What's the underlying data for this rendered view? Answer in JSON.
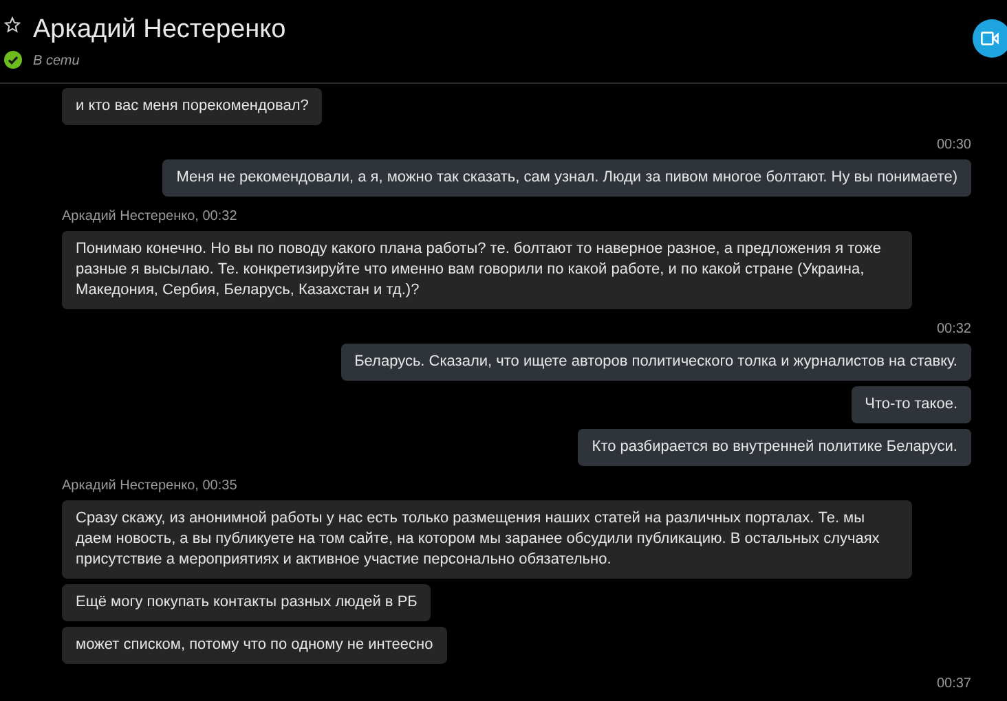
{
  "header": {
    "name": "Аркадий Нестеренко",
    "status": "В сети",
    "online": true
  },
  "groups": [
    {
      "kind": "incoming",
      "messages": [
        "и кто вас меня порекомендовал?"
      ]
    },
    {
      "kind": "outgoing",
      "meta": "00:30",
      "messages": [
        "Меня не рекомендовали, а я, можно так сказать, сам узнал. Люди за пивом многое болтают. Ну вы понимаете)"
      ]
    },
    {
      "kind": "incoming",
      "meta": "Аркадий Нестеренко, 00:32",
      "messages": [
        "Понимаю конечно. Но вы по поводу какого плана работы? те. болтают то наверное разное, а предложения я тоже разные я высылаю. Те. конкретизируйте что именно вам говорили по какой работе, и по какой стране (Украина, Македония, Сербия, Беларусь, Казахстан и тд.)?"
      ]
    },
    {
      "kind": "outgoing",
      "meta": "00:32",
      "messages": [
        "Беларусь. Сказали, что ищете авторов политического толка и журналистов на ставку.",
        "Что-то такое.",
        "Кто разбирается во внутренней политике Беларуси."
      ]
    },
    {
      "kind": "incoming",
      "meta": "Аркадий Нестеренко, 00:35",
      "messages": [
        "Сразу скажу, из анонимной работы у нас есть только размещения наших статей на различных порталах. Те. мы даем новость, а вы публикуете на том сайте, на котором мы заранее обсудили публикацию. В остальных случаях присутствие а мероприятиях и активное участие персонально обязательно.",
        "Ещё могу покупать контакты разных людей в РБ",
        "может списком, потому что по одному не интеесно"
      ]
    },
    {
      "kind": "outgoing",
      "meta": "00:37"
    }
  ]
}
